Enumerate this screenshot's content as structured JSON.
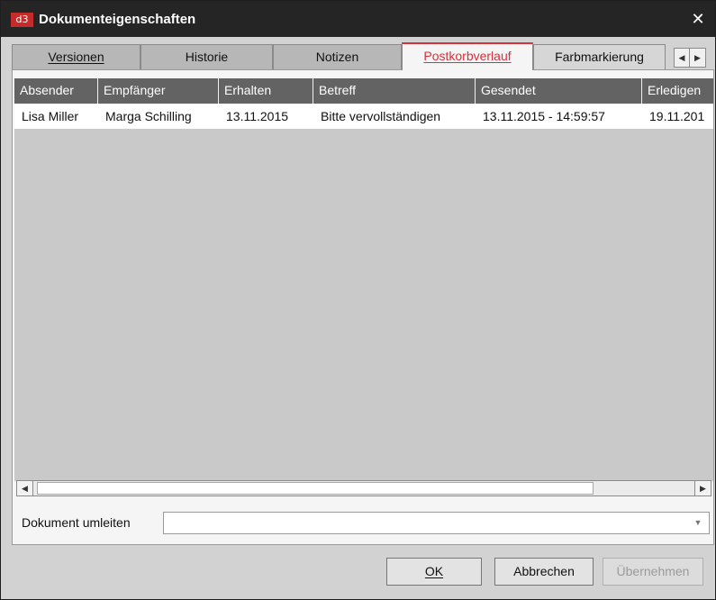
{
  "window": {
    "logo_text": "d3",
    "title": "Dokumenteigenschaften",
    "close_glyph": "✕"
  },
  "tabs": [
    {
      "label": "Versionen",
      "active": false
    },
    {
      "label": "Historie",
      "active": false
    },
    {
      "label": "Notizen",
      "active": false
    },
    {
      "label": "Postkorbverlauf",
      "active": true
    },
    {
      "label": "Farbmarkierung",
      "active": false
    }
  ],
  "tab_scroll": {
    "left_glyph": "◀",
    "right_glyph": "▶"
  },
  "table": {
    "columns": [
      "Absender",
      "Empfänger",
      "Erhalten",
      "Betreff",
      "Gesendet",
      "Erledigen"
    ],
    "rows": [
      [
        "Lisa Miller",
        "Marga Schilling",
        "13.11.2015",
        "Bitte vervollständigen",
        "13.11.2015 - 14:59:57",
        "19.11.201"
      ]
    ]
  },
  "hscroll": {
    "left_glyph": "◀",
    "right_glyph": "▶"
  },
  "redirect": {
    "label": "Dokument umleiten",
    "value": "",
    "arrow_glyph": "▼"
  },
  "buttons": {
    "ok": "OK",
    "cancel": "Abbrechen",
    "apply": "Übernehmen"
  },
  "colors": {
    "accent": "#d9313a",
    "titlebar": "#252526",
    "header": "#636363"
  }
}
